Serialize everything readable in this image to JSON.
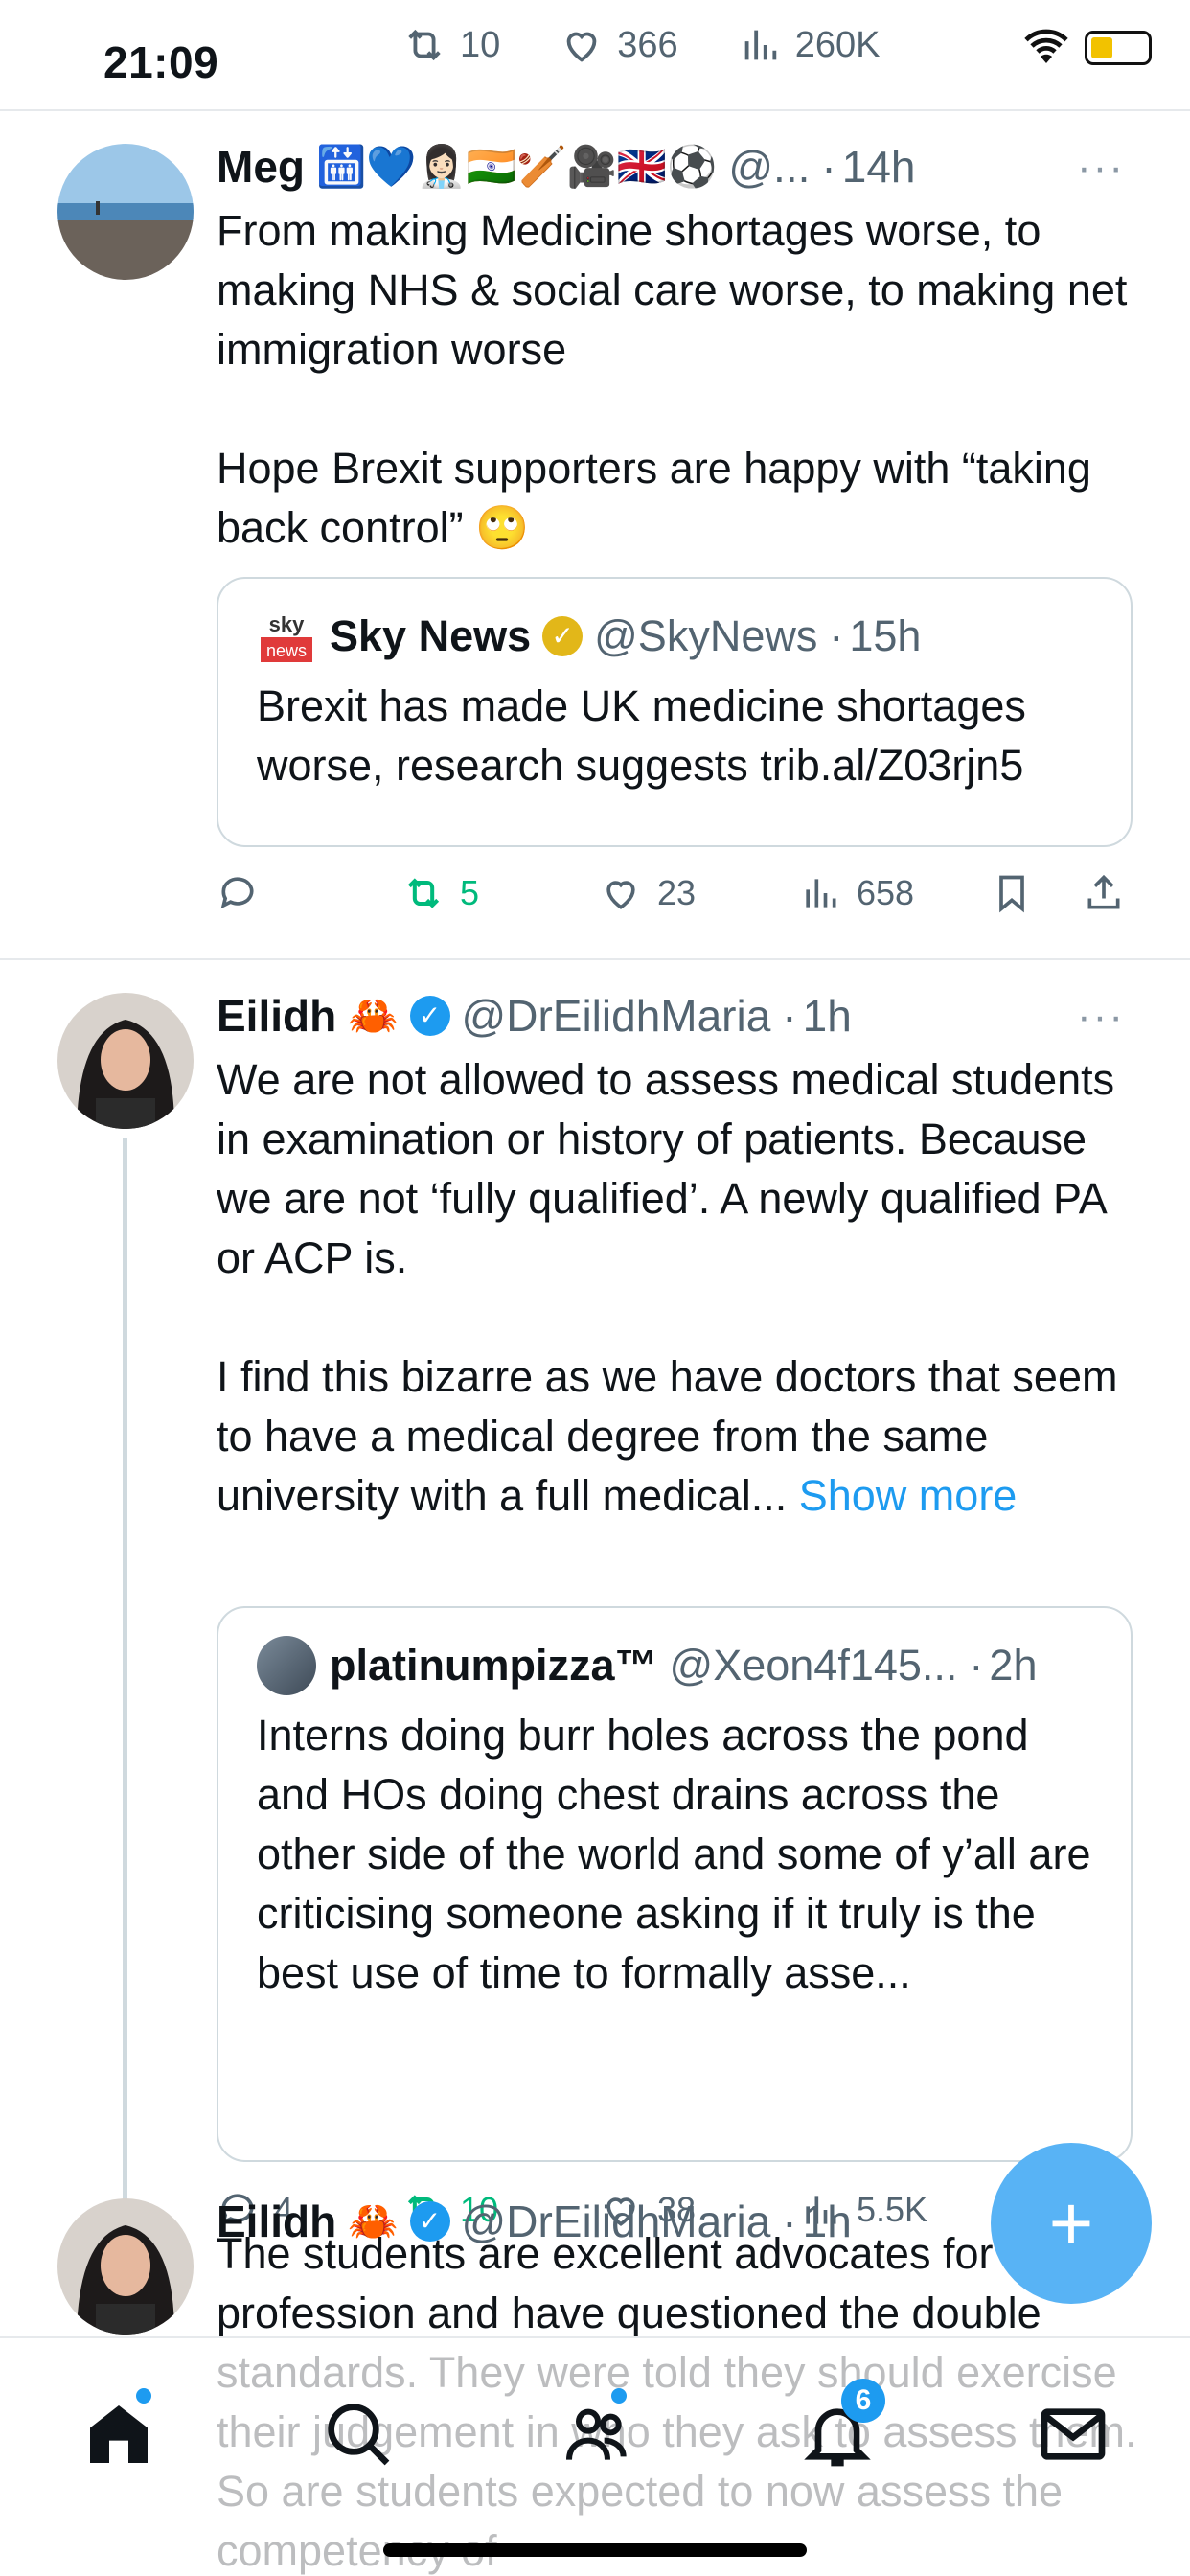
{
  "status_bar": {
    "time": "21:09",
    "ghost_retweets": "10",
    "ghost_likes": "366",
    "ghost_views": "260K"
  },
  "tweets": [
    {
      "name": "Meg",
      "name_emojis": "🛗💙👩🏻‍⚕️🇮🇳🏏🎥🇬🇧⚽",
      "handle": "@...",
      "time": "14h",
      "text": "From making Medicine shortages worse, to making NHS & social care worse, to making net immigration worse\n\nHope Brexit supporters are happy with “taking back control” 🙄",
      "quote": {
        "name": "Sky News",
        "handle": "@SkyNews",
        "time": "15h",
        "text": "Brexit has made UK medicine shortages worse, research suggests trib.al/Z03rjn5"
      },
      "actions": {
        "reply": "",
        "retweet": "5",
        "like": "23",
        "views": "658"
      }
    },
    {
      "name": "Eilidh",
      "name_emoji": "🦀",
      "handle": "@DrEilidhMaria",
      "time": "1h",
      "text": "We are not allowed to assess medical students in examination or history of patients. Because we are not ‘fully qualified’. A newly qualified PA or ACP is.\n\nI find this bizarre as we have doctors that seem to have a medical degree from the same university with a full medical... ",
      "show_more": "Show more",
      "quote": {
        "name": "platinumpizza™",
        "handle": "@Xeon4f145...",
        "time": "2h",
        "text": "Interns doing burr holes across the pond and HOs doing chest drains across the other side of the world and some of y’all are criticising someone asking if it truly is the best use of time to formally asse..."
      },
      "actions": {
        "reply": "4",
        "retweet": "10",
        "like": "38",
        "views": "5.5K"
      }
    },
    {
      "name": "Eilidh",
      "name_emoji": "🦀",
      "handle": "@DrEilidhMaria",
      "time": "1h",
      "text": "The students are excellent advocates for our profession and have questioned the double standards. They were told they should exercise their judgement in who they ask to assess them. So are students expected to now assess the competency of"
    }
  ],
  "bottom_nav": {
    "notifications_badge": "6"
  },
  "colors": {
    "accent": "#1d9bf0",
    "retweet_green": "#00ba7c",
    "muted": "#536471"
  }
}
